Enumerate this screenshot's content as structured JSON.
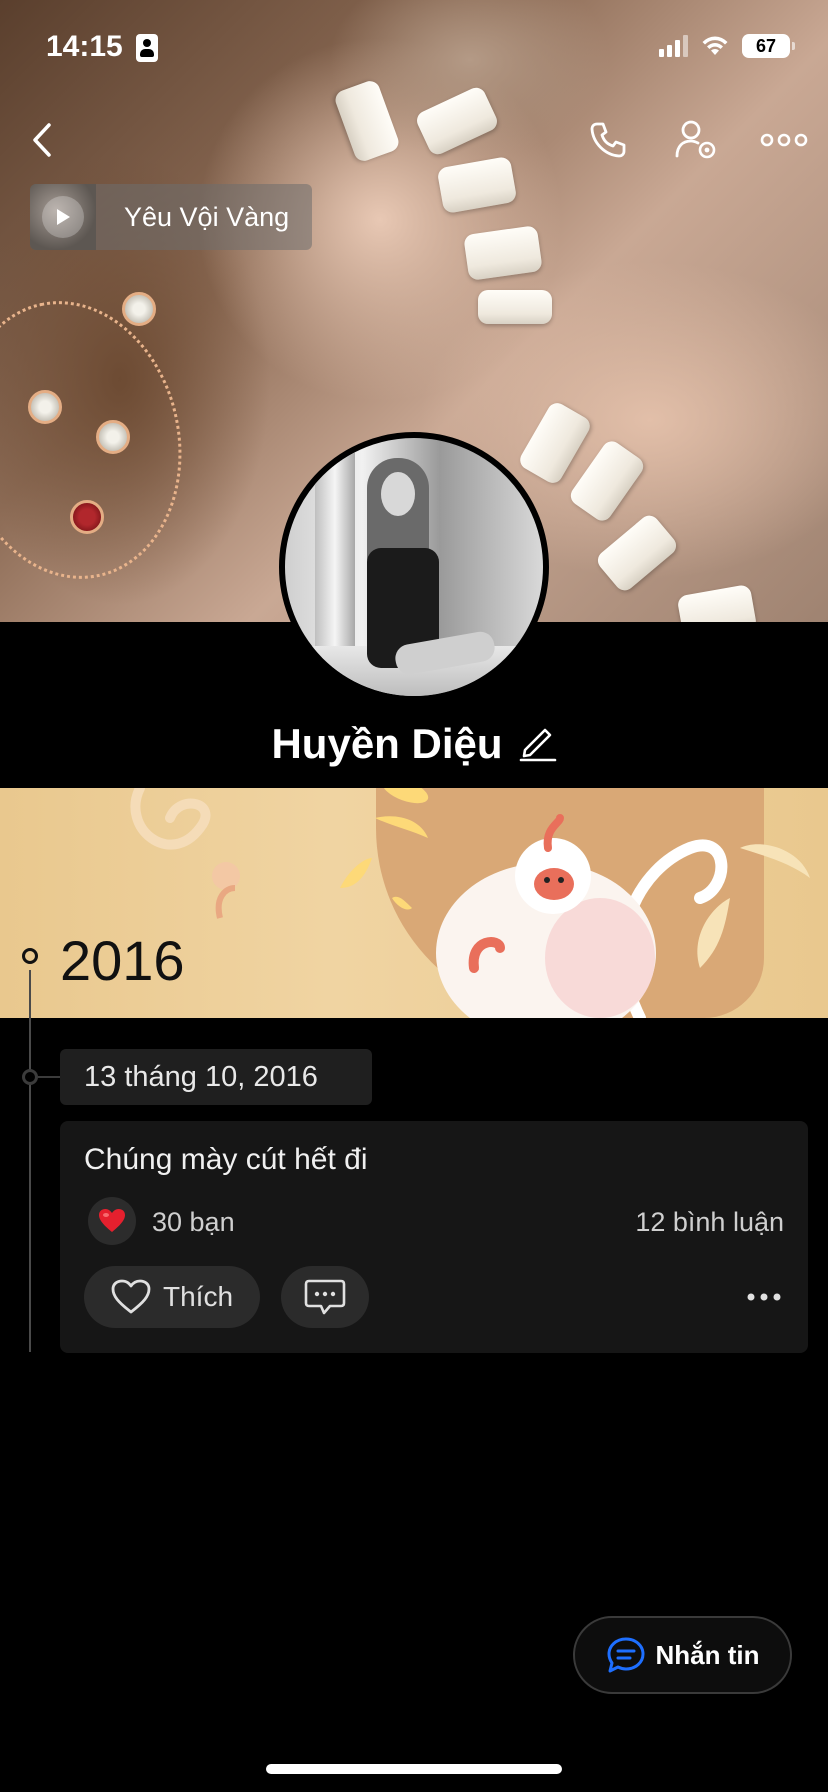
{
  "status_bar": {
    "time": "14:15",
    "battery": "67"
  },
  "header": {
    "back_icon": "chevron-left-icon",
    "actions": [
      {
        "icon": "phone-icon"
      },
      {
        "icon": "user-settings-icon"
      },
      {
        "icon": "more-horizontal-icon"
      }
    ]
  },
  "profile_music": {
    "title": "Yêu Vội Vàng",
    "icon": "play-icon"
  },
  "profile": {
    "name": "Huyền Diệu",
    "edit_icon": "pencil-icon"
  },
  "timeline": {
    "year": "2016",
    "date": "13 tháng 10, 2016",
    "post": {
      "text": "Chúng mày cút hết đi",
      "reaction_icon": "heart-icon",
      "reactions": "30 bạn",
      "comments": "12 bình luận",
      "like_label": "Thích"
    }
  },
  "message_button": {
    "label": "Nhắn tin",
    "icon": "chat-bubble-icon"
  },
  "colors": {
    "accent_blue": "#1e6fff",
    "heart_red": "#e5202e",
    "banner": "#eccc94"
  }
}
